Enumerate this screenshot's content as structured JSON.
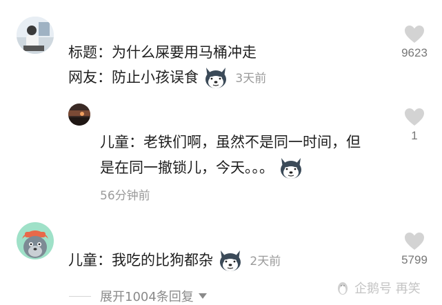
{
  "comments": [
    {
      "lines": [
        "标题：为什么屎要用马桶冲走",
        "网友：防止小孩误食"
      ],
      "emoji": "husky-emoji",
      "time": "3天前",
      "likes": "9623",
      "heart_icon": "heart-icon"
    },
    {
      "lines": [
        "儿童：老铁们啊，虽然不是同一时间，但",
        "是在同一撤锁儿，今天。。。"
      ],
      "emoji": "husky-emoji",
      "time": "56分钟前",
      "likes": "1",
      "heart_icon": "heart-icon"
    },
    {
      "lines": [
        "儿童：我吃的比狗都杂"
      ],
      "emoji": "husky-emoji",
      "time": "2天前",
      "likes": "5799",
      "heart_icon": "heart-icon"
    }
  ],
  "expand": {
    "label": "展开1004条回复",
    "icon": "caret-down-icon"
  },
  "watermark": {
    "icon": "penguin-icon",
    "text": "企鹅号 再笑"
  }
}
